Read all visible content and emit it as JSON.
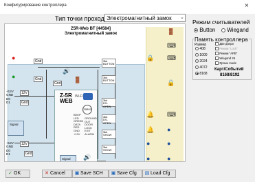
{
  "window": {
    "title": "Конфигурирование контроллера",
    "close_glyph": "×"
  },
  "top": {
    "passage_label": "Тип точки прохода",
    "passage_value": "Электромагнитный замок",
    "arrow": "⌄"
  },
  "diagram": {
    "title_line1": "Z5R-Web BT [44584]",
    "title_line2": "Электромагнитный замок",
    "controller_name_1": "Z-5R",
    "controller_name_2": "WEB",
    "wifi": "Wi-Fi",
    "pins": [
      "BEEP",
      "LED",
      "GREEN",
      "DATA",
      "RED",
      "GND",
      "+12V"
    ],
    "pins_right": [
      "GROUND",
      "OUT",
      "DOOR",
      "LOCK",
      "EXIT",
      "ALARM"
    ],
    "gnd": "Gnd",
    "v12": "+12V",
    "v12_lbl": "12V",
    "left_block": [
      "+12V",
      "GND",
      "D0",
      "D1"
    ],
    "left_block2": [
      "+12V",
      "GND",
      "D0",
      "D1"
    ],
    "relays": [
      {
        "a": "3kk",
        "b": "BUTTON",
        "c": "3kk"
      },
      {
        "a": "3kk",
        "b": "BUTTON",
        "c": "3kk"
      },
      {
        "a": "3kk",
        "b": "DS-OPEN",
        "c": "3kk"
      },
      {
        "a": "3kk",
        "b": "DS-OPEN",
        "c": "3kk"
      },
      {
        "a": "3kk",
        "b": "SHOW",
        "c": "3kk"
      },
      {
        "a": "3kk",
        "b": "SHOW",
        "c": "3kk"
      }
    ],
    "signal1": "Signal",
    "signal2": "Signal",
    "ctrl_small": "Z5R02",
    "icons": {
      "keypad": "⌨",
      "door_exit": "🚪",
      "alarm": "🔔",
      "lock": "🔒",
      "speaker": "🔊",
      "led_red": "●",
      "led_green": "●"
    }
  },
  "reader_mode": {
    "title": "Режим считывателей",
    "options": [
      "Button",
      "Wiegand"
    ],
    "selected": "Button"
  },
  "memory": {
    "title": "Память контроллера",
    "size_label": "Размер",
    "sizes": [
      "408",
      "1000",
      "2024",
      "4072",
      "8168"
    ],
    "selected_size": "8168",
    "flags": [
      {
        "label": "Две двери",
        "checked": false,
        "dim": false
      },
      {
        "label": "Режим \"Lock\"",
        "checked": false,
        "dim": true
      },
      {
        "label": "Режим \"APB\"",
        "checked": false,
        "dim": false
      },
      {
        "label": "Wiegand 26",
        "checked": false,
        "dim": false
      },
      {
        "label": "Ярлык mode",
        "checked": false,
        "dim": false
      }
    ],
    "cards_label": "Карт/Событий",
    "cards_value": "8168/8192"
  },
  "buttons": {
    "ok": "OK",
    "cancel": "Cancel",
    "save_sch": "Save SCH",
    "save_cfg": "Save Cfg",
    "load_cfg": "Load Cfg"
  },
  "colors": {
    "accent": "#1b63b7",
    "ok_check": "#2a8a2a",
    "cancel_x": "#c42020"
  }
}
